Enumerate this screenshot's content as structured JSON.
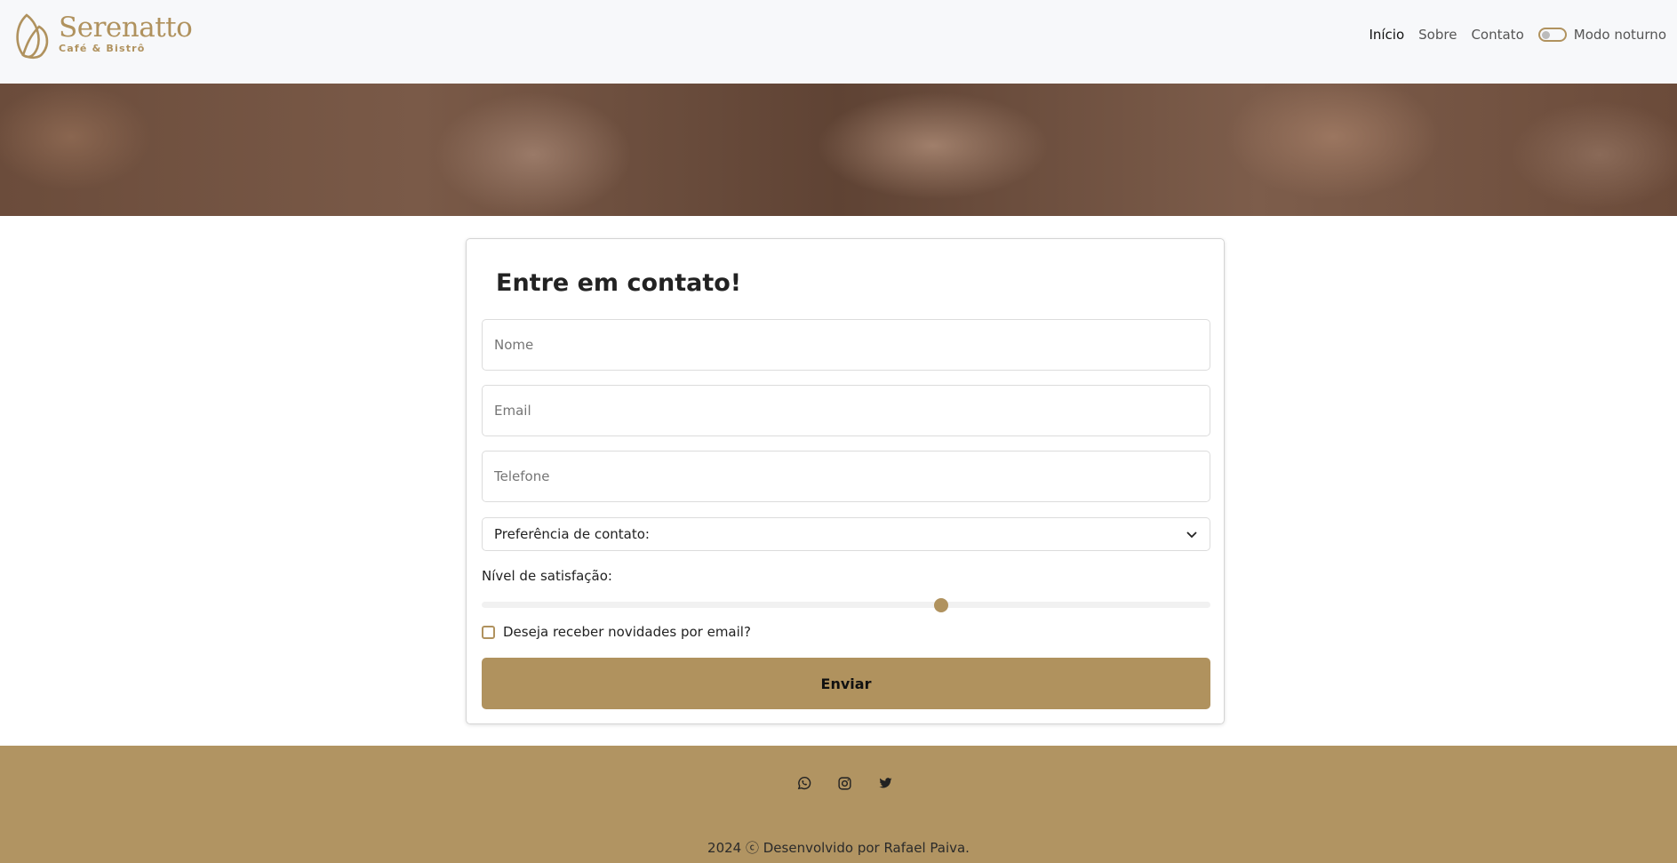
{
  "header": {
    "brand": "Serenatto",
    "tagline": "Café & Bistrô",
    "nav": [
      "Início",
      "Sobre",
      "Contato"
    ],
    "dark_mode_label": "Modo noturno",
    "dark_mode_on": false
  },
  "form": {
    "title": "Entre em contato!",
    "name_placeholder": "Nome",
    "email_placeholder": "Email",
    "phone_placeholder": "Telefone",
    "contact_pref": "Preferência de contato:",
    "satisfaction_label": "Nível de satisfação:",
    "satisfaction_value": 63,
    "newsletter_label": "Deseja receber novidades por email?",
    "newsletter_checked": false,
    "submit": "Enviar"
  },
  "footer": {
    "social": [
      "whatsapp-icon",
      "instagram-icon",
      "twitter-icon"
    ],
    "copyright": "2024 ⓒ Desenvolvido por Rafael Paiva."
  },
  "colors": {
    "accent": "#b0925e"
  }
}
